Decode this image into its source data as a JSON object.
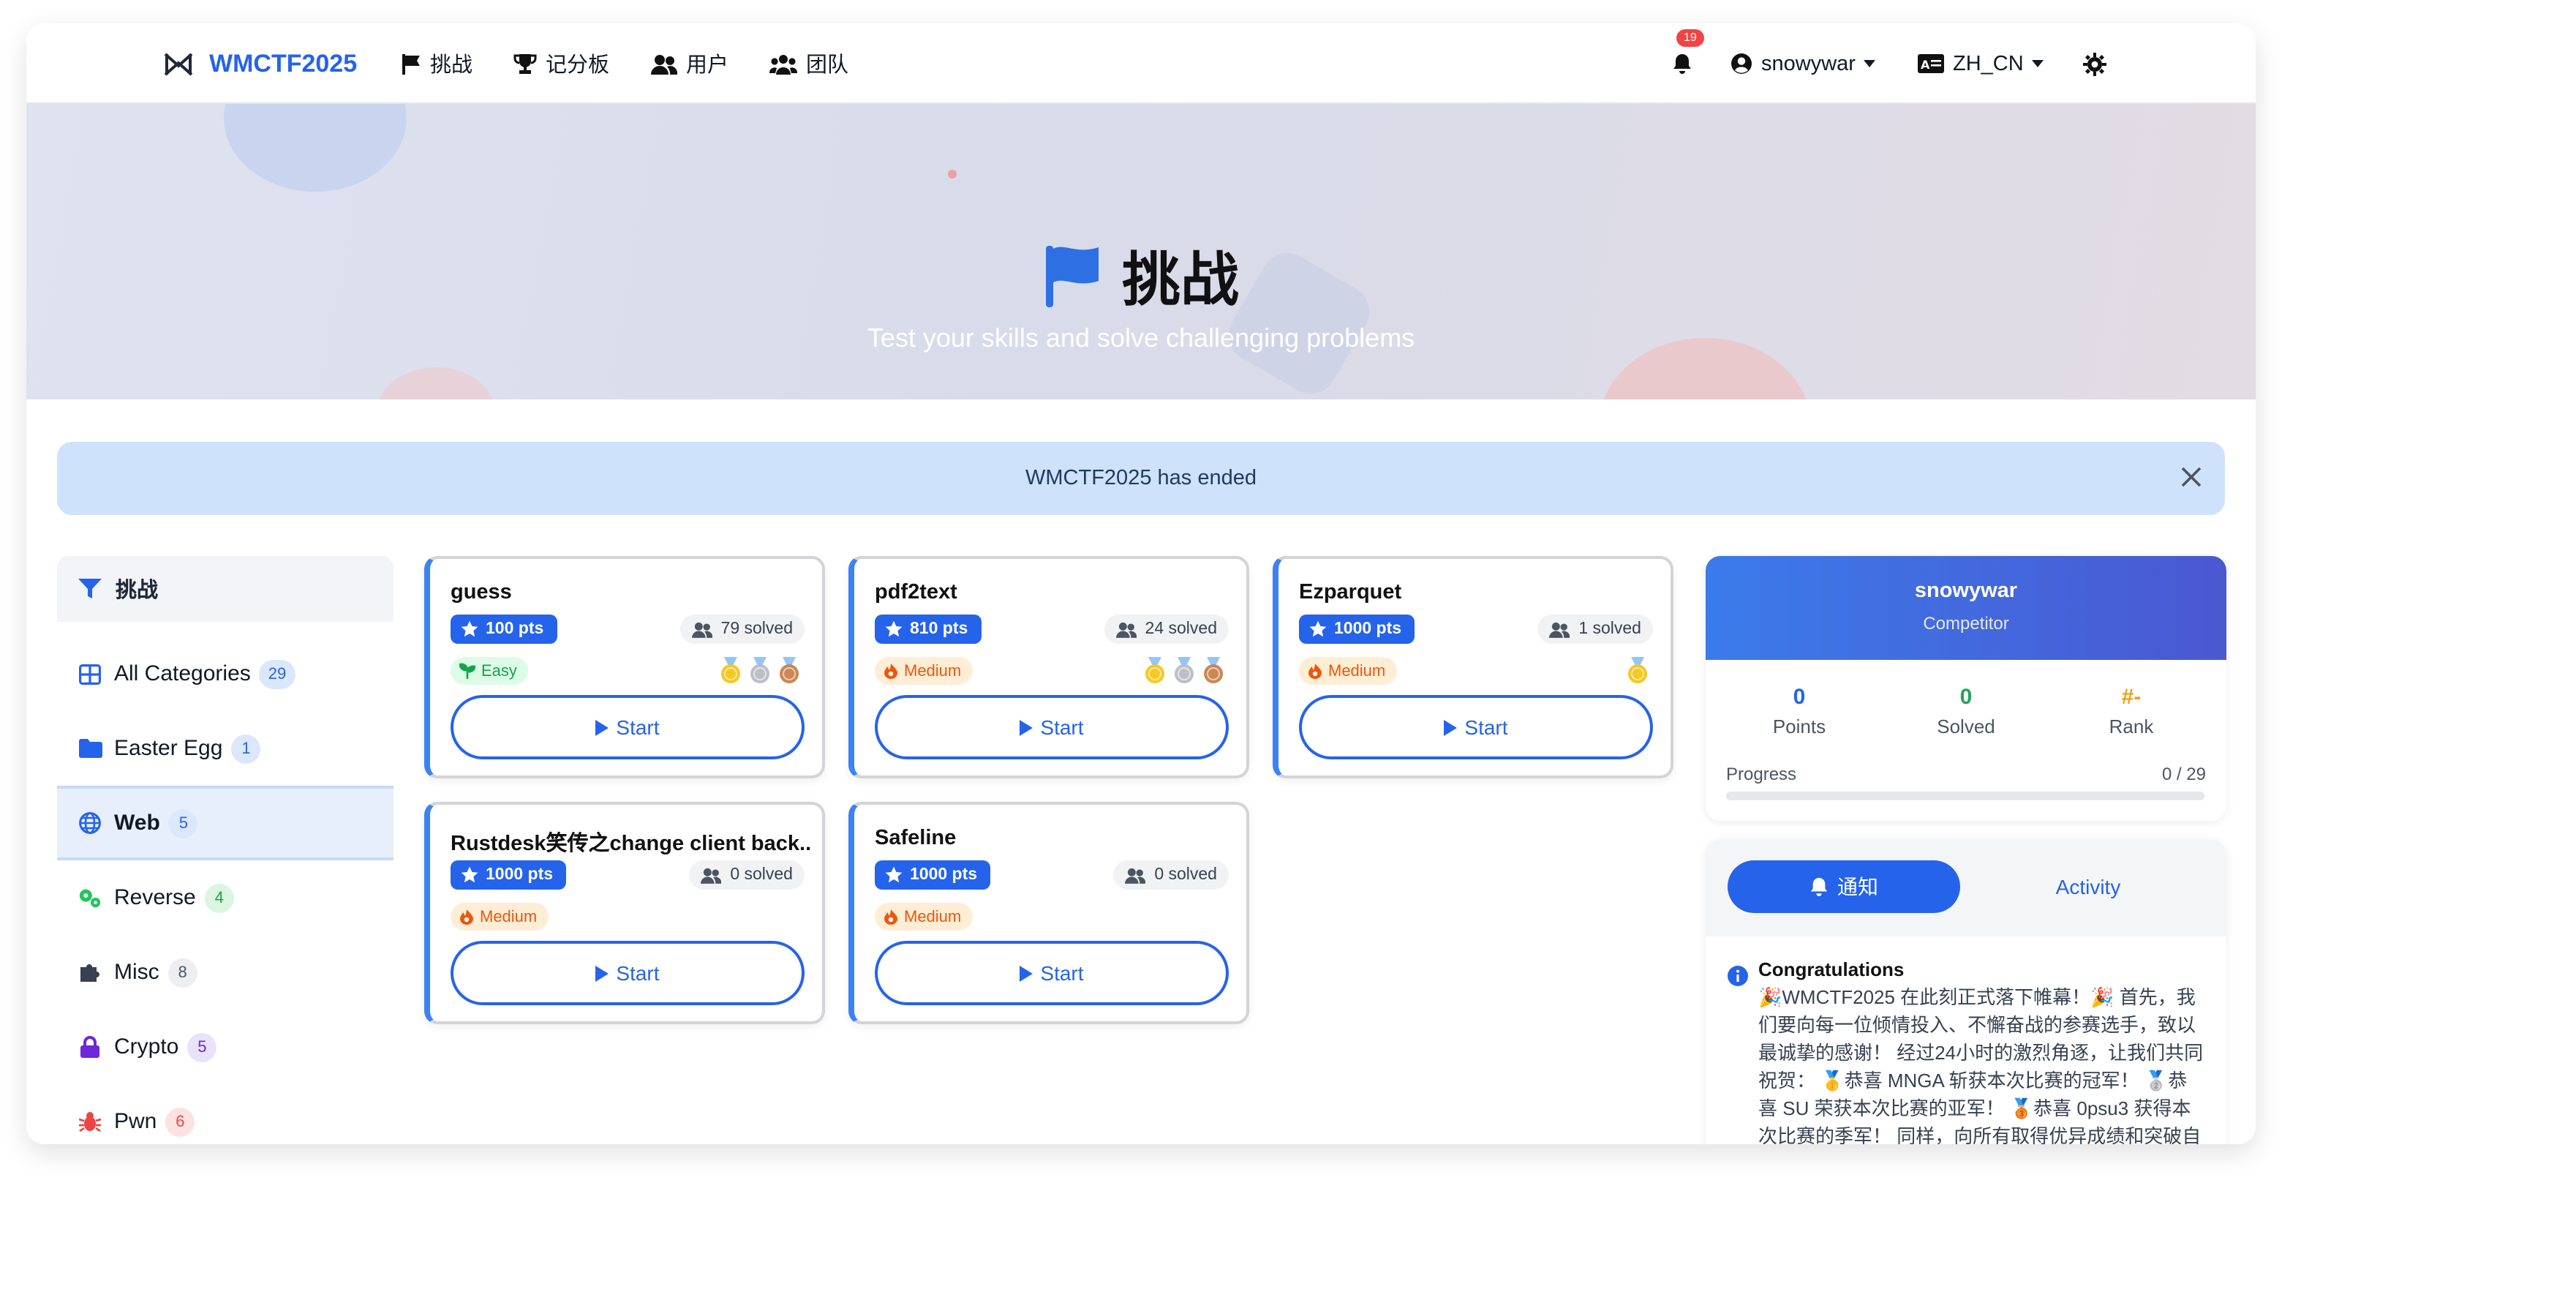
{
  "navbar": {
    "brand": "WMCTF2025",
    "links": [
      "挑战",
      "记分板",
      "用户",
      "团队"
    ],
    "notification_count": "19",
    "username": "snowywar",
    "language": "ZH_CN"
  },
  "hero": {
    "title": "挑战",
    "subtitle": "Test your skills and solve challenging problems"
  },
  "alert": {
    "text": "WMCTF2025 has ended"
  },
  "sidebar": {
    "header": "挑战",
    "items": [
      {
        "label": "All Categories",
        "count": "29",
        "icon": "grid-icon",
        "color": "#2563eb"
      },
      {
        "label": "Easter Egg",
        "count": "1",
        "icon": "folder-icon",
        "color": "#2563eb"
      },
      {
        "label": "Web",
        "count": "5",
        "icon": "globe-icon",
        "color": "#2563eb"
      },
      {
        "label": "Reverse",
        "count": "4",
        "icon": "gears-icon",
        "color": "#22c55e"
      },
      {
        "label": "Misc",
        "count": "8",
        "icon": "puzzle-icon",
        "color": "#374151"
      },
      {
        "label": "Crypto",
        "count": "5",
        "icon": "lock-icon",
        "color": "#6d28d9"
      },
      {
        "label": "Pwn",
        "count": "6",
        "icon": "bug-icon",
        "color": "#ef4444"
      }
    ]
  },
  "challenges": [
    {
      "title": "guess",
      "points": "100 pts",
      "solved": "79 solved",
      "difficulty": "Easy",
      "medals": [
        "gold",
        "silver",
        "bronze"
      ],
      "start": "Start"
    },
    {
      "title": "pdf2text",
      "points": "810 pts",
      "solved": "24 solved",
      "difficulty": "Medium",
      "medals": [
        "gold",
        "silver",
        "bronze"
      ],
      "start": "Start"
    },
    {
      "title": "Ezparquet",
      "points": "1000 pts",
      "solved": "1 solved",
      "difficulty": "Medium",
      "medals": [
        "gold"
      ],
      "start": "Start"
    },
    {
      "title": "Rustdesk笑传之change client back...",
      "points": "1000 pts",
      "solved": "0 solved",
      "difficulty": "Medium",
      "medals": [],
      "start": "Start"
    },
    {
      "title": "Safeline",
      "points": "1000 pts",
      "solved": "0 solved",
      "difficulty": "Medium",
      "medals": [],
      "start": "Start"
    }
  ],
  "profile": {
    "name": "snowywar",
    "role": "Competitor",
    "points_value": "0",
    "points_label": "Points",
    "solved_value": "0",
    "solved_label": "Solved",
    "rank_value": "#-",
    "rank_label": "Rank",
    "progress_label": "Progress",
    "progress_text": "0 / 29",
    "progress_fraction": 0
  },
  "notices": {
    "tab_active": "通知",
    "tab_other": "Activity",
    "title": "Congratulations",
    "body": "🎉WMCTF2025 在此刻正式落下帷幕！🎉 首先，我们要向每一位倾情投入、不懈奋战的参赛选手，致以最诚挚的感谢！ 经过24小时的激烈角逐，让我们共同祝贺： 🥇恭喜 MNGA 斩获本次比赛的冠军！ 🥈恭喜 SU 荣获本次比赛的亚军！ 🥉恭喜 0psu3 获得本次比赛的季军！ 同样，向所有取得优异成绩和突破自我的队伍表"
  },
  "colors": {
    "accent": "#2563eb",
    "easy_bg": "#dcfce7",
    "easy_fg": "#16a34a",
    "medium_bg": "#ffedd5",
    "medium_fg": "#ea580c"
  }
}
